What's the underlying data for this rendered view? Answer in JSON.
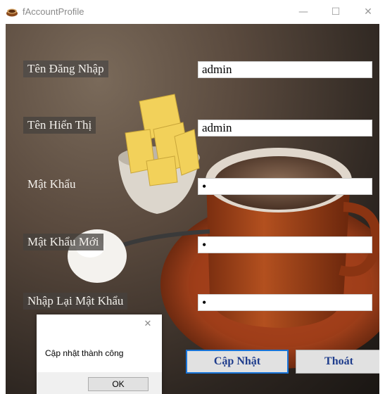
{
  "window": {
    "title": "fAccountProfile",
    "icon": "coffee-cup-icon",
    "minimize_glyph": "—",
    "maximize_glyph": "☐",
    "close_glyph": "✕"
  },
  "form": {
    "fields": [
      {
        "label": "Tên Đăng Nhập",
        "value": "admin"
      },
      {
        "label": "Tên Hiển Thị",
        "value": "admin"
      },
      {
        "label": "Mật Khẩu",
        "value": "•"
      },
      {
        "label": "Mật Khẩu Mới",
        "value": "•"
      },
      {
        "label": "Nhập Lại Mật Khẩu",
        "value": "•"
      }
    ],
    "update_button": "Cập Nhật",
    "exit_button": "Thoát"
  },
  "message_box": {
    "text": "Cập nhật thành công",
    "ok_button": "OK",
    "close_glyph": "✕"
  },
  "colors": {
    "button_text": "#1e3c8c",
    "focus_border": "#1874d8"
  }
}
